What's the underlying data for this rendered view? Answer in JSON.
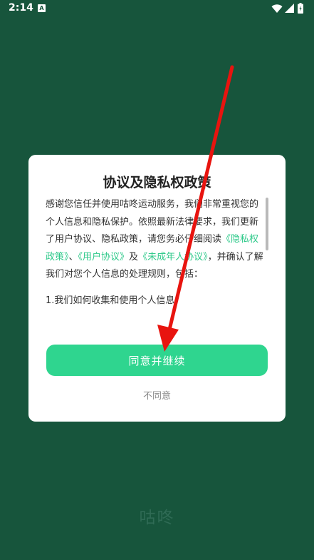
{
  "status_bar": {
    "time": "2:14",
    "notification_icon": "A"
  },
  "dialog": {
    "title": "协议及隐私权政策",
    "body": {
      "intro": "感谢您信任并使用咕咚运动服务，我们非常重视您的个人信息和隐私保护。依照最新法律要求，我们更新了用户协议、隐私政策，请您务必仔细阅读",
      "link_privacy": "《隐私权政策》",
      "sep1": "、",
      "link_user": "《用户协议》",
      "sep2": "及",
      "link_minor": "《未成年人协议》",
      "outro": "，并确认了解我们对您个人信息的处理规则，包括：",
      "item1": "1.我们如何收集和使用个人信息"
    },
    "agree_label": "同意并继续",
    "disagree_label": "不同意"
  },
  "splash": {
    "app_name": "咕咚"
  },
  "colors": {
    "background": "#17553c",
    "accent": "#2fd58f",
    "link": "#2ec98a",
    "annotation_arrow": "#e8140f"
  }
}
